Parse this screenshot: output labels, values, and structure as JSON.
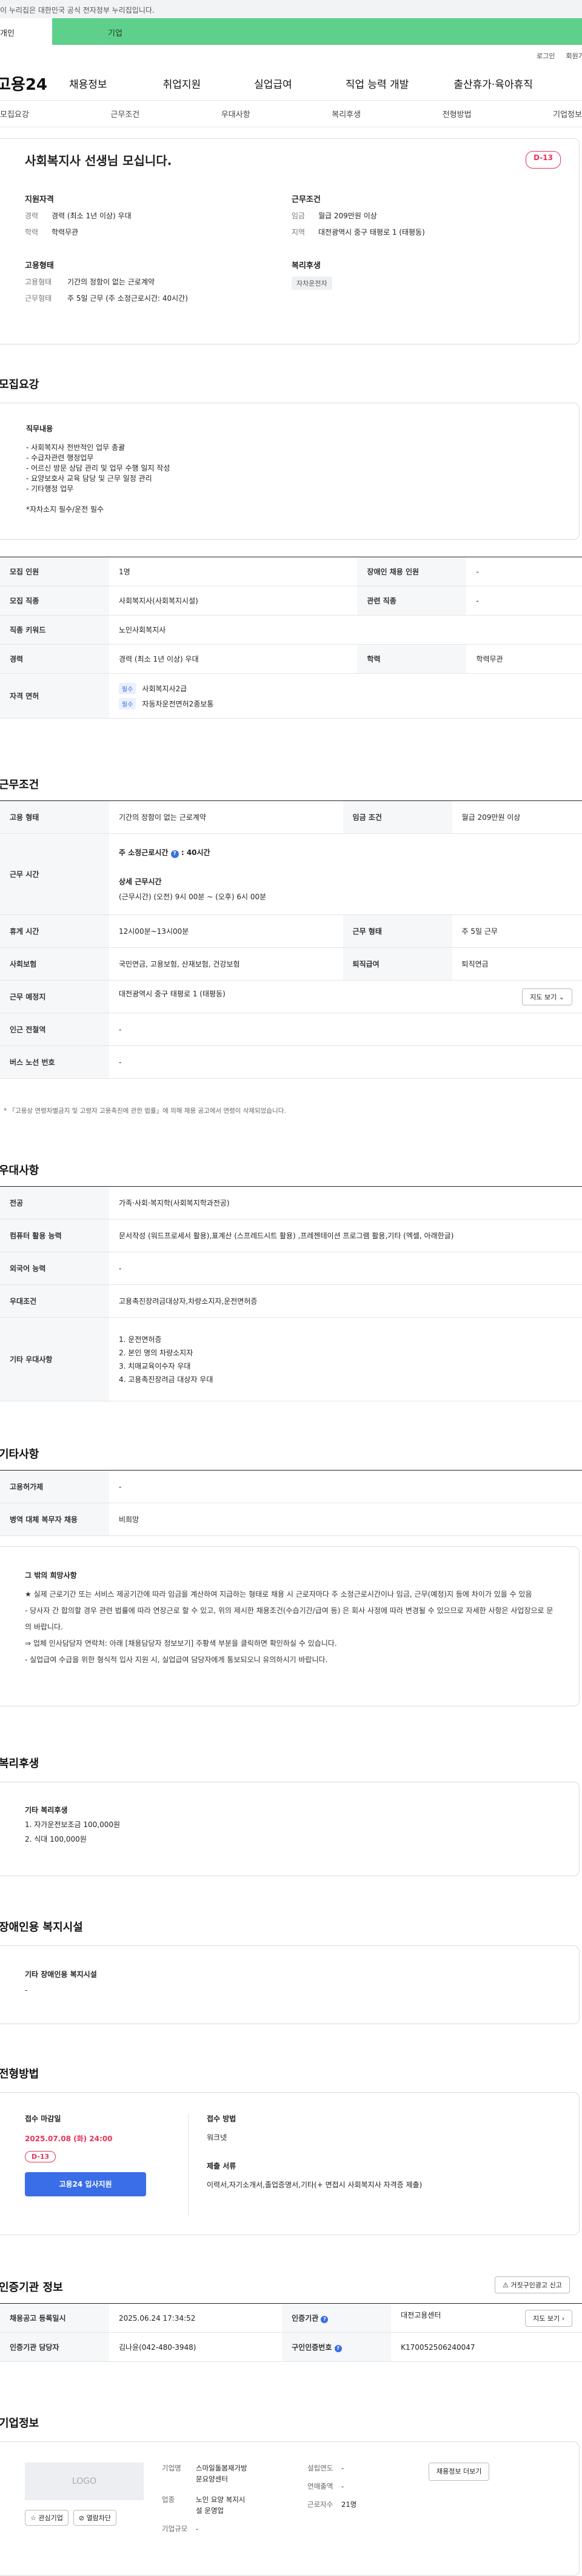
{
  "gov_banner": "이 누리집은 대한민국 공식 전자정부 누리집입니다.",
  "top_tabs": {
    "personal": "개인",
    "corp": "기업"
  },
  "util": {
    "login": "로그인",
    "join": "회원가입"
  },
  "logo": "고용24",
  "gnb": [
    "채용정보",
    "취업지원",
    "실업급여",
    "직업 능력 개발",
    "출산휴가·육아휴직"
  ],
  "subnav": [
    "모집요강",
    "근무조건",
    "우대사항",
    "복리후생",
    "전형방법",
    "기업정보"
  ],
  "job": {
    "title": "사회복지사 선생님 모십니다.",
    "dday": "D-13",
    "qual_title": "지원자격",
    "career_k": "경력",
    "career_v": "경력 (최소 1년 이상) 우대",
    "edu_k": "학력",
    "edu_v": "학력무관",
    "cond_title": "근무조건",
    "wage_k": "임금",
    "wage_v": "월급 209만원 이상",
    "area_k": "지역",
    "area_v": "대전광역시 중구 태평로 1 (태평동)",
    "emp_title": "고용형태",
    "emp_k": "고용형태",
    "emp_v": "기간의 정함이 없는 근로계약",
    "hours_k": "근무형태",
    "hours_v": "주 5일 근무 (주 소정근로시간: 40시간)",
    "welfare_title": "복리후생",
    "welfare_chip": "자차운전자"
  },
  "recruit": {
    "title": "모집요강",
    "duties_title": "직무내용",
    "duties": [
      "- 사회복지사 전반적인 업무 총괄",
      "- 수급자관련 행정업무",
      "- 어르신 방문 상담 관리 및 업무 수행 일지 작성",
      "- 요양보호사 교육 담당 및 근무 일정 관리",
      "- 기타행정 업무",
      "",
      "*자차소지 필수/운전 필수"
    ],
    "rows": {
      "count_k": "모집 인원",
      "count_v": "1명",
      "dis_k": "장애인 채용 인원",
      "dis_v": "-",
      "job_k": "모집 직종",
      "job_v": "사회복지사(사회복지시설)",
      "rel_k": "관련 직종",
      "rel_v": "-",
      "kw_k": "직종 키워드",
      "kw_v": "노인사회복지사",
      "car_k": "경력",
      "car_v": "경력 (최소 1년 이상) 우대",
      "edu_k": "학력",
      "edu_v": "학력무관",
      "lic_k": "자격 면허",
      "lic1_tag": "필수",
      "lic1": "사회복지사2급",
      "lic2_tag": "필수",
      "lic2": "자동차운전면허2종보통"
    }
  },
  "conditions": {
    "title": "근무조건",
    "emp_k": "고용 형태",
    "emp_v": "기간의 정함이 없는 근로계약",
    "wage_k": "임금 조건",
    "wage_v": "월급 209만원 이상",
    "time_k": "근무 시간",
    "week_hours": "주 소정근로시간",
    "week_hours_v": "40시간",
    "detail_title": "상세 근무시간",
    "detail_v": "(근무시간) (오전) 9시 00분 ~ (오후) 6시 00분",
    "rest_k": "휴게 시간",
    "rest_v": "12시00분~13시00분",
    "type_k": "근무 형태",
    "type_v": "주 5일 근무",
    "ins_k": "사회보험",
    "ins_v": "국민연금, 고용보험, 산재보험, 건강보험",
    "ret_k": "퇴직급여",
    "ret_v": "퇴직연금",
    "loc_k": "근무 예정지",
    "loc_v": "대전광역시 중구 태평로 1 (태평동)",
    "map_btn": "지도 보기",
    "sub_k": "인근 전철역",
    "sub_v": "-",
    "bus_k": "버스 노선 번호",
    "bus_v": "-",
    "note": "「고용상 연령차별금지 및 고령자 고용촉진에 관한 법률」에 의해 채용 공고에서 연령이 삭제되었습니다."
  },
  "prefer": {
    "title": "우대사항",
    "major_k": "전공",
    "major_v": "가족·사회·복지학(사회복지학과전공)",
    "pc_k": "컴퓨터 활용 능력",
    "pc_v": "문서작성 (워드프로세서 활용),표계산 (스프레드시트 활용) ,프레젠테이션 프로그램 활용,기타 (엑셀, 아래한글)",
    "lang_k": "외국어 능력",
    "lang_v": "-",
    "cond_k": "우대조건",
    "cond_v": "고용촉진장려금대상자,차량소지자,운전면허증",
    "etc_k": "기타 우대사항",
    "etc_items": [
      "1. 운전면허증",
      "2. 본인 명의 차량소지자",
      "3. 치매교육이수자 우대",
      "4. 고용촉진장려금 대상자 우대"
    ]
  },
  "other": {
    "title": "기타사항",
    "bene_k": "고용허가제",
    "bene_v": "-",
    "mil_k": "병역 대체 복무자 채용",
    "mil_v": "비희망",
    "notice_title": "그 밖의 희망사항",
    "notice": [
      "★ 실제 근로기간 또는 서비스 제공기간에 따라 임금을 계산하여 지급하는 형태로 채용 시 근로자마다 주 소정근로시간이나 임금, 근무(예정)지 등에 차이가 있을 수 있음",
      "- 당사자 간 합의할 경우 관련 법률에 따라 연장근로 할 수 있고, 위의 제시한 채용조건(수습기간/급여 등) 은 회사 사정에 따라 변경될 수 있으므로 자세한 사항은 사업장으로 문의 바랍니다.",
      "⇒ 업체 인사담당자 연락처: 아래 [채용담당자 정보보기] 주황색 부분을 클릭하면 확인하실 수 있습니다.",
      "- 실업급여 수급을 위한 형식적 입사 지원 시, 실업급여 담당자에게 통보되오니 유의하시기 바랍니다."
    ]
  },
  "welfare": {
    "title": "복리후생",
    "box_title": "기타 복리후생",
    "items": [
      "1. 자가운전보조금 100,000원",
      "2. 식대 100,000원"
    ]
  },
  "disability": {
    "title": "장애인용 복지시설",
    "box_title": "기타 장애인용 복지시설",
    "value": "-"
  },
  "process": {
    "title": "전형방법",
    "deadline_k": "접수 마감일",
    "deadline_v": "2025.07.08 (화) 24:00",
    "dday": "D-13",
    "apply_btn": "고용24 입사지원",
    "method_k": "접수 방법",
    "method_v": "워크넷",
    "docs_k": "제출 서류",
    "docs_v": "이력서,자기소개서,졸업증명서,기타(+ 면접시 사회복지사 자격증 제출)"
  },
  "agency": {
    "title": "인증기관 정보",
    "report_btn": "거짓구인광고 신고",
    "reg_k": "채용공고 등록일시",
    "reg_v": "2025.06.24 17:34:52",
    "org_k": "인증기관",
    "org_v": "대전고용센터",
    "map_btn": "지도 보기",
    "mgr_k": "인증기관 담당자",
    "mgr_v": "김나윤(042-480-3948)",
    "id_k": "구인인증번호",
    "id_v": "K170052506240047"
  },
  "company": {
    "title": "기업정보",
    "logo": "LOGO",
    "fav_btn": "관심기업",
    "block_btn": "열람차단",
    "info_btn": "채용정보 더보기",
    "name_k": "기업명",
    "name_v1": "스마일돌봄재가방",
    "name_v2": "문요양센터",
    "ind_k": "업종",
    "ind_v1": "노인 요양 복지시",
    "ind_v2": "설 운영업",
    "size_k": "기업규모",
    "size_v": "-",
    "year_k": "설립연도",
    "year_v": "-",
    "sales_k": "연매출액",
    "sales_v": "-",
    "emp_k": "근로자수",
    "emp_v": "21명"
  },
  "colors": {
    "accent": "#5ed08c",
    "primary": "#3a6ee8",
    "dday": "#e8325a"
  }
}
